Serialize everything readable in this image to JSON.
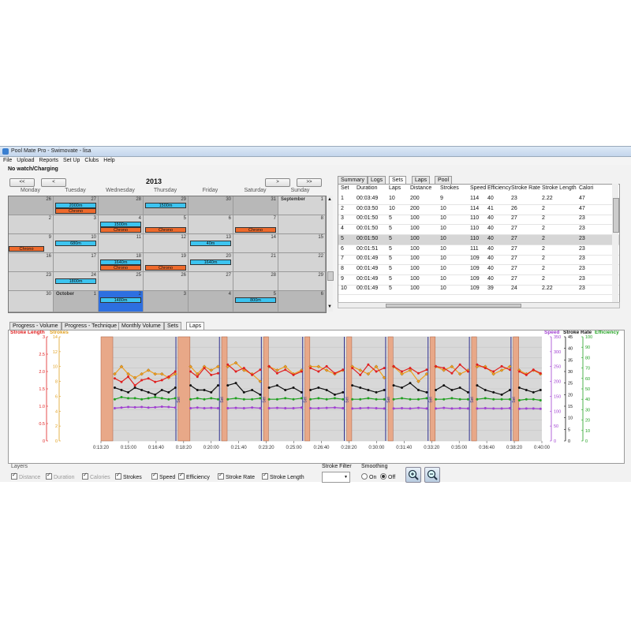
{
  "window": {
    "title": "Pool Mate Pro - Swimovate - lisa"
  },
  "menu": [
    "File",
    "Upload",
    "Reports",
    "Set Up",
    "Clubs",
    "Help"
  ],
  "status": "No watch/Charging",
  "calendar": {
    "nav": {
      "first": "<<",
      "prev": "<",
      "next": ">",
      "last": ">>"
    },
    "year": "2013",
    "days": [
      "Monday",
      "Tuesday",
      "Wednesday",
      "Thursday",
      "Friday",
      "Saturday",
      "Sunday"
    ],
    "rows": [
      [
        {
          "n": "26",
          "d": 1
        },
        {
          "n": "27",
          "d": 1
        },
        {
          "n": "28",
          "d": 1
        },
        {
          "n": "29",
          "d": 1
        },
        {
          "n": "30",
          "d": 1
        },
        {
          "n": "31",
          "d": 1
        },
        {
          "n": "1",
          "m": "September"
        }
      ],
      [
        {
          "n": "2"
        },
        {
          "n": "3"
        },
        {
          "n": "4"
        },
        {
          "n": "5"
        },
        {
          "n": "6"
        },
        {
          "n": "7"
        },
        {
          "n": "8"
        }
      ],
      [
        {
          "n": "9"
        },
        {
          "n": "10"
        },
        {
          "n": "11"
        },
        {
          "n": "12"
        },
        {
          "n": "13"
        },
        {
          "n": "14"
        },
        {
          "n": "15"
        }
      ],
      [
        {
          "n": "16"
        },
        {
          "n": "17"
        },
        {
          "n": "18"
        },
        {
          "n": "19"
        },
        {
          "n": "20"
        },
        {
          "n": "21"
        },
        {
          "n": "22"
        }
      ],
      [
        {
          "n": "23"
        },
        {
          "n": "24"
        },
        {
          "n": "25"
        },
        {
          "n": "26"
        },
        {
          "n": "27"
        },
        {
          "n": "28"
        },
        {
          "n": "29"
        }
      ],
      [
        {
          "n": "30"
        },
        {
          "n": "1",
          "m": "October",
          "d": 1
        },
        {
          "n": "2",
          "d": 1,
          "s": 1
        },
        {
          "n": "3",
          "d": 1
        },
        {
          "n": "4",
          "d": 1
        },
        {
          "n": "5",
          "d": 1
        },
        {
          "n": "6",
          "d": 1
        }
      ]
    ],
    "events": [
      {
        "r": 0,
        "c": 1,
        "slot": 0,
        "label": "2000m",
        "kind": "blue"
      },
      {
        "r": 0,
        "c": 1,
        "slot": 1,
        "label": "Chrono",
        "kind": "orange"
      },
      {
        "r": 0,
        "c": 3,
        "slot": 0,
        "label": "1500m",
        "kind": "blue"
      },
      {
        "r": 1,
        "c": 2,
        "slot": 0,
        "label": "1500m",
        "kind": "blue"
      },
      {
        "r": 1,
        "c": 2,
        "slot": 1,
        "label": "Chrono",
        "kind": "orange"
      },
      {
        "r": 1,
        "c": 3,
        "slot": 1,
        "label": "Chrono",
        "kind": "orange"
      },
      {
        "r": 1,
        "c": 5,
        "slot": 1,
        "label": "Chrono",
        "kind": "orange"
      },
      {
        "r": 2,
        "c": 0,
        "slot": 1,
        "label": "Chrono",
        "kind": "orange"
      },
      {
        "r": 2,
        "c": 1,
        "slot": 0,
        "label": "680m",
        "kind": "blue"
      },
      {
        "r": 2,
        "c": 4,
        "slot": 0,
        "label": "40m",
        "kind": "blue"
      },
      {
        "r": 3,
        "c": 2,
        "slot": 0,
        "label": "1640m",
        "kind": "blue"
      },
      {
        "r": 3,
        "c": 2,
        "slot": 1,
        "label": "Chrono",
        "kind": "orange"
      },
      {
        "r": 3,
        "c": 3,
        "slot": 1,
        "label": "Chrono",
        "kind": "orange"
      },
      {
        "r": 3,
        "c": 4,
        "slot": 0,
        "label": "1640m",
        "kind": "blue"
      },
      {
        "r": 4,
        "c": 1,
        "slot": 0,
        "label": "1800m",
        "kind": "blue"
      },
      {
        "r": 5,
        "c": 2,
        "slot": 0,
        "label": "1480m",
        "kind": "blue"
      },
      {
        "r": 5,
        "c": 5,
        "slot": 0,
        "label": "800m",
        "kind": "blue"
      }
    ]
  },
  "table": {
    "tabs": [
      "Summary",
      "Logs",
      "Sets",
      "Laps",
      "Pool"
    ],
    "active_tab": "Sets",
    "columns": [
      "Set",
      "Duration",
      "Laps",
      "Distance",
      "Strokes",
      "Speed",
      "Efficiency",
      "Stroke Rate",
      "Stroke Length",
      "Calori"
    ],
    "rows": [
      [
        "1",
        "00:03:49",
        "10",
        "200",
        "9",
        "114",
        "40",
        "23",
        "2.22",
        "47"
      ],
      [
        "2",
        "00:03:50",
        "10",
        "200",
        "10",
        "114",
        "41",
        "26",
        "2",
        "47"
      ],
      [
        "3",
        "00:01:50",
        "5",
        "100",
        "10",
        "110",
        "40",
        "27",
        "2",
        "23"
      ],
      [
        "4",
        "00:01:50",
        "5",
        "100",
        "10",
        "110",
        "40",
        "27",
        "2",
        "23"
      ],
      [
        "5",
        "00:01:50",
        "5",
        "100",
        "10",
        "110",
        "40",
        "27",
        "2",
        "23"
      ],
      [
        "6",
        "00:01:51",
        "5",
        "100",
        "10",
        "111",
        "40",
        "27",
        "2",
        "23"
      ],
      [
        "7",
        "00:01:49",
        "5",
        "100",
        "10",
        "109",
        "40",
        "27",
        "2",
        "23"
      ],
      [
        "8",
        "00:01:49",
        "5",
        "100",
        "10",
        "109",
        "40",
        "27",
        "2",
        "23"
      ],
      [
        "9",
        "00:01:49",
        "5",
        "100",
        "10",
        "109",
        "40",
        "27",
        "2",
        "23"
      ],
      [
        "10",
        "00:01:49",
        "5",
        "100",
        "10",
        "109",
        "39",
        "24",
        "2.22",
        "23"
      ]
    ],
    "selected_row": 4
  },
  "chart_tabs": [
    "Progress - Volume",
    "Progress - Technique",
    "Monthly Volume",
    "Sets",
    "Laps"
  ],
  "chart_active_tab": "Laps",
  "colors": {
    "stroke_length": "#e02020",
    "strokes": "#f0a020",
    "speed": "#a040d0",
    "stroke_rate": "#111111",
    "efficiency": "#20a020",
    "rest": "#e8a888",
    "divider": "#303090"
  },
  "chart_data": {
    "type": "line",
    "left_axis_labels": {
      "stroke_length": "Stroke Length",
      "strokes": "Strokes"
    },
    "right_axis_labels": {
      "speed": "Speed",
      "stroke_rate": "Stroke Rate",
      "efficiency": "Efficiency"
    },
    "x_ticks": [
      "0:13:20",
      "0:15:00",
      "0:16:40",
      "0:18:20",
      "0:20:00",
      "0:21:40",
      "0:23:20",
      "0:25:00",
      "0:26:40",
      "0:28:20",
      "0:30:00",
      "0:31:40",
      "0:33:20",
      "0:35:00",
      "0:36:40",
      "0:38:20",
      "0:40:00"
    ],
    "x_range_sec": [
      800,
      2400
    ],
    "y_axes": {
      "stroke_length": {
        "range": [
          0,
          3
        ],
        "ticks": [
          "0",
          "0.5",
          "1.0",
          "1.5",
          "2.0",
          "2.5",
          "3"
        ]
      },
      "strokes": {
        "range": [
          0,
          14
        ],
        "ticks": [
          "0",
          "2",
          "4",
          "6",
          "8",
          "10",
          "12",
          "14"
        ]
      },
      "speed": {
        "range": [
          0,
          350
        ],
        "ticks": [
          "0",
          "50",
          "100",
          "150",
          "200",
          "250",
          "300",
          "350"
        ]
      },
      "stroke_rate": {
        "range": [
          0,
          45
        ],
        "ticks": [
          "0",
          "5",
          "10",
          "15",
          "20",
          "25",
          "30",
          "35",
          "40",
          "45"
        ]
      },
      "efficiency": {
        "range": [
          0,
          100
        ],
        "ticks": [
          "0",
          "10",
          "20",
          "30",
          "40",
          "50",
          "60",
          "70",
          "80",
          "90",
          "100"
        ]
      }
    },
    "rest_intervals_sec": [
      [
        800,
        843
      ],
      [
        1080,
        1123
      ],
      [
        1238,
        1258
      ],
      [
        1390,
        1408
      ],
      [
        1540,
        1558
      ],
      [
        1692,
        1710
      ],
      [
        1842,
        1860
      ],
      [
        1995,
        2013
      ],
      [
        2145,
        2163
      ],
      [
        2296,
        2316
      ]
    ],
    "divider_lines_sec": [
      1072,
      1230,
      1382,
      1532,
      1683,
      1833,
      1987,
      2137,
      2288
    ],
    "set_label": "Set",
    "sets": [
      {
        "start": 850,
        "end": 1070,
        "stroke_length": [
          1.8,
          1.7,
          1.85,
          1.6,
          1.75,
          1.8,
          1.7,
          1.75,
          1.85,
          2.0
        ],
        "stroke_rate": [
          23,
          22,
          21,
          23,
          22,
          21,
          20,
          22,
          21,
          23
        ],
        "strokes": [
          9,
          10,
          9,
          8.5,
          9,
          9.5,
          9,
          9,
          8.5,
          9
        ],
        "efficiency": [
          40,
          42,
          41,
          41,
          40,
          41,
          42,
          41,
          40,
          41
        ],
        "speed": [
          110,
          112,
          114,
          113,
          114,
          112,
          113,
          115,
          114,
          112
        ]
      },
      {
        "start": 1125,
        "end": 1225,
        "stroke_length": [
          2.0,
          1.85,
          2.1,
          1.9,
          1.95
        ],
        "stroke_rate": [
          24,
          22,
          22,
          21,
          24
        ],
        "strokes": [
          10,
          9,
          10,
          9.5,
          10
        ],
        "efficiency": [
          40,
          41,
          40,
          41,
          40
        ],
        "speed": [
          110,
          112,
          110,
          111,
          110
        ]
      },
      {
        "start": 1260,
        "end": 1378,
        "stroke_length": [
          2.2,
          2.0,
          2.1,
          1.9,
          2.05
        ],
        "stroke_rate": [
          24,
          25,
          21,
          22,
          20
        ],
        "strokes": [
          10,
          10.5,
          9.5,
          9,
          8
        ],
        "efficiency": [
          40,
          41,
          40,
          40,
          41
        ],
        "speed": [
          110,
          111,
          110,
          112,
          110
        ]
      },
      {
        "start": 1410,
        "end": 1528,
        "stroke_length": [
          2.15,
          1.95,
          2.05,
          1.9,
          2.0
        ],
        "stroke_rate": [
          23,
          24,
          22,
          23,
          21
        ],
        "strokes": [
          10,
          9.5,
          10,
          9,
          9.5
        ],
        "efficiency": [
          40,
          40,
          41,
          40,
          41
        ],
        "speed": [
          110,
          111,
          110,
          110,
          112
        ]
      },
      {
        "start": 1560,
        "end": 1678,
        "stroke_length": [
          2.1,
          2.0,
          2.15,
          1.95,
          2.05
        ],
        "stroke_rate": [
          22,
          23,
          22,
          20,
          21
        ],
        "strokes": [
          10,
          10,
          9.5,
          9,
          9.5
        ],
        "efficiency": [
          40,
          41,
          40,
          41,
          40
        ],
        "speed": [
          110,
          110,
          111,
          112,
          110
        ]
      },
      {
        "start": 1712,
        "end": 1828,
        "stroke_length": [
          2.1,
          1.9,
          2.2,
          2.0,
          2.1
        ],
        "stroke_rate": [
          24,
          23,
          22,
          21,
          22
        ],
        "strokes": [
          10,
          9.5,
          9,
          10,
          8.5
        ],
        "efficiency": [
          40,
          40,
          41,
          40,
          40
        ],
        "speed": [
          109,
          110,
          111,
          110,
          109
        ]
      },
      {
        "start": 1862,
        "end": 1982,
        "stroke_length": [
          2.15,
          2.0,
          2.1,
          1.95,
          2.05
        ],
        "stroke_rate": [
          24,
          23,
          25,
          22,
          21
        ],
        "strokes": [
          10,
          9,
          9.5,
          8,
          9
        ],
        "efficiency": [
          40,
          41,
          40,
          40,
          41
        ],
        "speed": [
          109,
          110,
          109,
          111,
          109
        ]
      },
      {
        "start": 2015,
        "end": 2132,
        "stroke_length": [
          2.15,
          2.1,
          1.95,
          2.2,
          2.0
        ],
        "stroke_rate": [
          22,
          24,
          22,
          23,
          21
        ],
        "strokes": [
          10,
          9.5,
          10,
          9,
          9.5
        ],
        "efficiency": [
          40,
          40,
          41,
          40,
          40
        ],
        "speed": [
          109,
          111,
          109,
          110,
          109
        ]
      },
      {
        "start": 2165,
        "end": 2284,
        "stroke_length": [
          2.2,
          2.1,
          2.0,
          2.15,
          2.05
        ],
        "stroke_rate": [
          24,
          22,
          21,
          20,
          22
        ],
        "strokes": [
          10,
          10,
          9,
          9.5,
          10
        ],
        "efficiency": [
          40,
          41,
          40,
          40,
          40
        ],
        "speed": [
          109,
          110,
          109,
          109,
          110
        ]
      },
      {
        "start": 2318,
        "end": 2395,
        "stroke_length": [
          2.0,
          1.9,
          2.05,
          1.95
        ],
        "stroke_rate": [
          23,
          22,
          21,
          22
        ],
        "strokes": [
          9.5,
          9,
          9.5,
          9
        ],
        "efficiency": [
          39,
          40,
          40,
          39
        ],
        "speed": [
          108,
          109,
          109,
          108
        ]
      }
    ]
  },
  "layers": {
    "title": "Layers",
    "items": [
      {
        "label": "Distance",
        "checked": true,
        "disabled": true
      },
      {
        "label": "Duration",
        "checked": true,
        "disabled": true
      },
      {
        "label": "Calories",
        "checked": true,
        "disabled": true
      },
      {
        "label": "Strokes",
        "checked": true,
        "disabled": false
      },
      {
        "label": "Speed",
        "checked": true,
        "disabled": false
      },
      {
        "label": "Efficiency",
        "checked": true,
        "disabled": false
      },
      {
        "label": "Stroke Rate",
        "checked": true,
        "disabled": false
      },
      {
        "label": "Stroke Length",
        "checked": true,
        "disabled": false
      }
    ]
  },
  "stroke_filter": {
    "label": "Stroke Filter",
    "value": ""
  },
  "smoothing": {
    "label": "Smoothing",
    "on_label": "On",
    "off_label": "Off",
    "value": "Off"
  }
}
